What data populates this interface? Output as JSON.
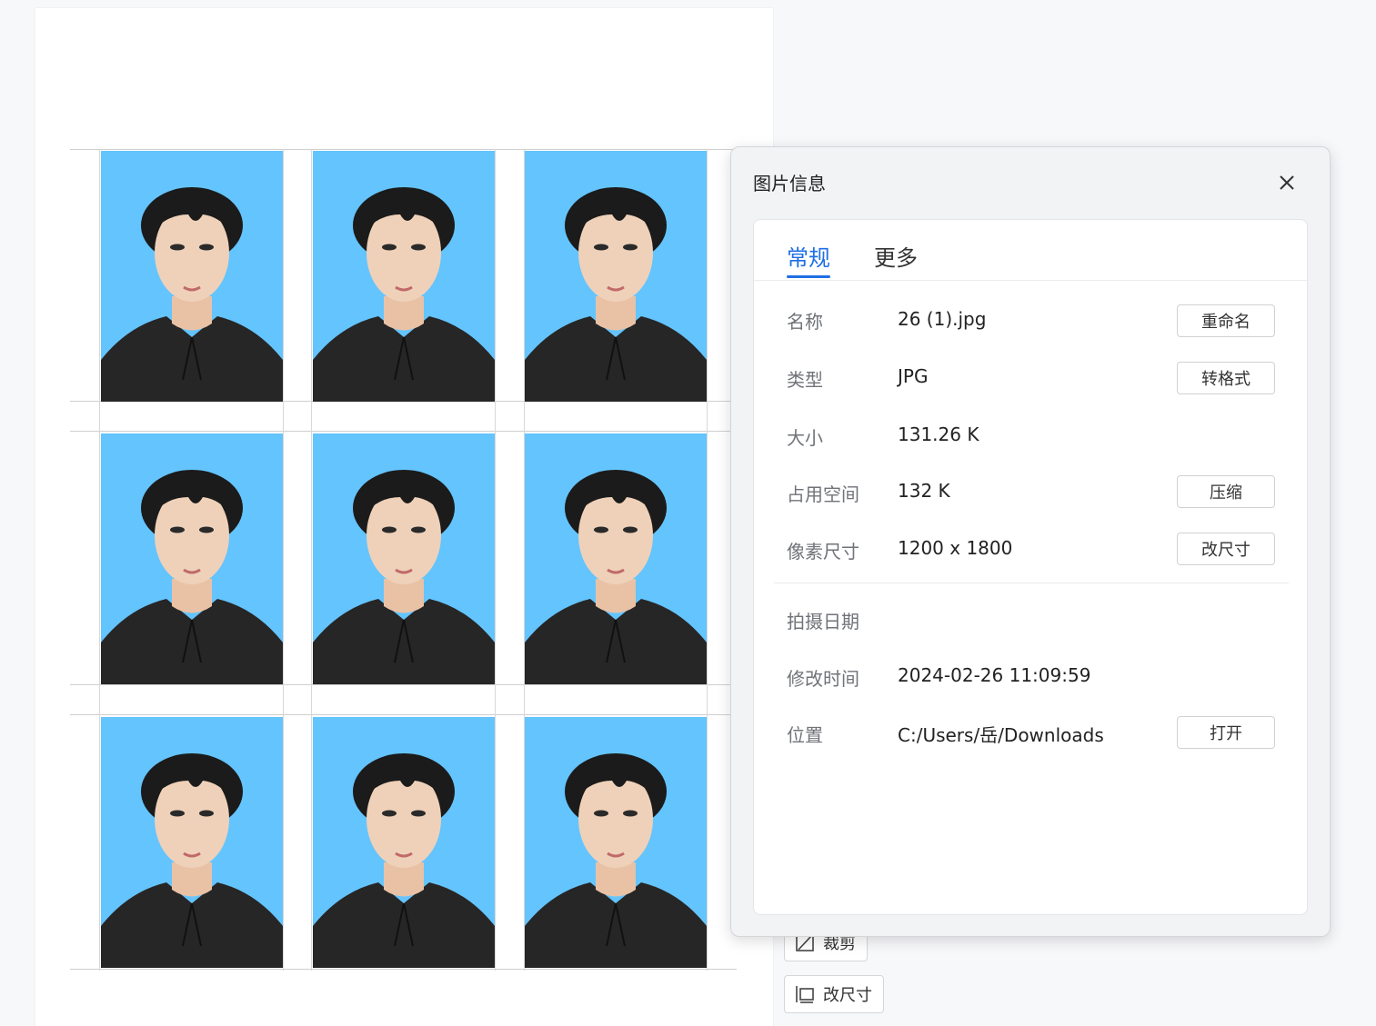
{
  "dialog": {
    "title": "图片信息",
    "tabs": [
      {
        "label": "常规",
        "active": true
      },
      {
        "label": "更多",
        "active": false
      }
    ],
    "rows": [
      {
        "label": "名称",
        "value": "26 (1).jpg",
        "action": "重命名"
      },
      {
        "label": "类型",
        "value": "JPG",
        "action": "转格式"
      },
      {
        "label": "大小",
        "value": "131.26 K",
        "action": ""
      },
      {
        "label": "占用空间",
        "value": "132 K",
        "action": "压缩"
      },
      {
        "label": "像素尺寸",
        "value": "1200 x 1800",
        "action": "改尺寸"
      },
      {
        "label": "拍摄日期",
        "value": "",
        "action": ""
      },
      {
        "label": "修改时间",
        "value": "2024-02-26 11:09:59",
        "action": ""
      },
      {
        "label": "位置",
        "value": "C:/Users/岳/Downloads",
        "action": "打开"
      }
    ]
  },
  "tools": {
    "crop_label": "裁剪",
    "resize_label": "改尺寸"
  },
  "photo_grid": {
    "rows": 3,
    "columns": 3,
    "background_color": "#64c4fd"
  },
  "colors": {
    "accent": "#1f6fe5",
    "photo_background": "#64c4fd"
  }
}
